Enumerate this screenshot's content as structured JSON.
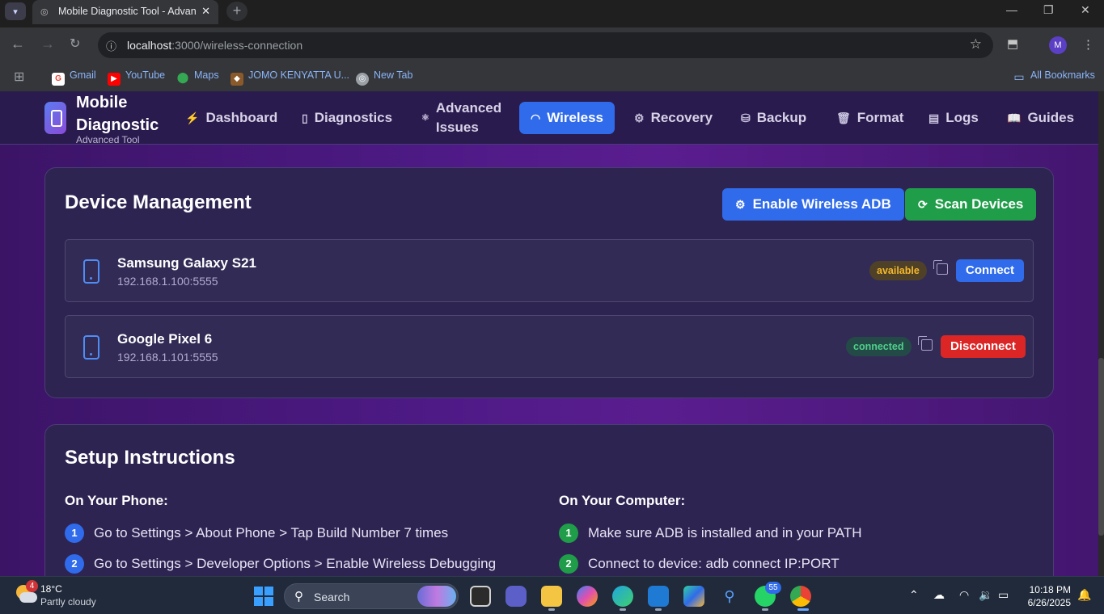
{
  "browser": {
    "tab_title": "Mobile Diagnostic Tool - Advan",
    "url_host": "localhost",
    "url_path": ":3000/wireless-connection",
    "profile_initial": "M",
    "bookmarks": [
      {
        "label": "Gmail",
        "color": "#ea4335"
      },
      {
        "label": "YouTube",
        "color": "#ff0000"
      },
      {
        "label": "Maps",
        "color": "#34a853"
      },
      {
        "label": "JOMO KENYATTA U...",
        "color": "#8a5a2b"
      },
      {
        "label": "New Tab",
        "color": "#9aa0a6"
      }
    ],
    "all_bookmarks": "All Bookmarks"
  },
  "app": {
    "brand_title": "Mobile Diagnostic",
    "brand_subtitle": "Advanced Tool",
    "nav": [
      {
        "label": "Dashboard",
        "icon": "activity-icon"
      },
      {
        "label": "Diagnostics",
        "icon": "phone-icon"
      },
      {
        "label": "Advanced Issues",
        "icon": "atom-icon"
      },
      {
        "label": "Wireless",
        "icon": "wifi-icon",
        "active": true
      },
      {
        "label": "Recovery",
        "icon": "gear-icon"
      },
      {
        "label": "Backup",
        "icon": "database-icon"
      },
      {
        "label": "Format",
        "icon": "trash-icon"
      },
      {
        "label": "Logs",
        "icon": "file-icon"
      },
      {
        "label": "Guides",
        "icon": "book-icon"
      }
    ]
  },
  "device_management": {
    "title": "Device Management",
    "enable_button": "Enable Wireless ADB",
    "scan_button": "Scan Devices",
    "devices": [
      {
        "name": "Samsung Galaxy S21",
        "address": "192.168.1.100:5555",
        "status": "available",
        "action": "Connect"
      },
      {
        "name": "Google Pixel 6",
        "address": "192.168.1.101:5555",
        "status": "connected",
        "action": "Disconnect"
      }
    ]
  },
  "setup": {
    "title": "Setup Instructions",
    "phone": {
      "title": "On Your Phone:",
      "steps": [
        {
          "n": "1",
          "text": "Go to Settings > About Phone > Tap Build Number 7 times"
        },
        {
          "n": "2",
          "text": "Go to Settings > Developer Options > Enable Wireless Debugging"
        }
      ]
    },
    "computer": {
      "title": "On Your Computer:",
      "steps": [
        {
          "n": "1",
          "text": "Make sure ADB is installed and in your PATH"
        },
        {
          "n": "2",
          "text": "Connect to device: adb connect IP:PORT"
        }
      ]
    }
  },
  "taskbar": {
    "weather_badge": "4",
    "temperature": "18°C",
    "weather_desc": "Partly cloudy",
    "search_placeholder": "Search",
    "whatsapp_badge": "55",
    "time": "10:18 PM",
    "date": "6/26/2025"
  },
  "colors": {
    "accent_blue": "#2f6bea",
    "scan_green": "#1f9d49",
    "disconnect_red": "#dc2626"
  }
}
